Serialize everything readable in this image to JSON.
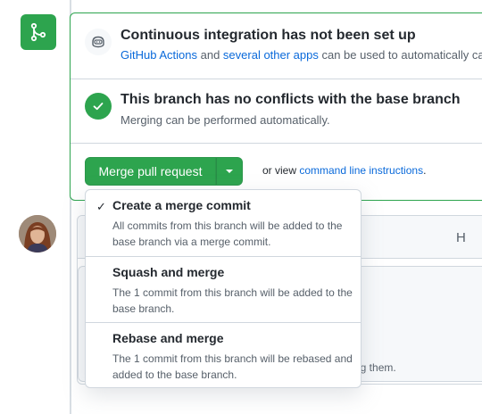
{
  "ci": {
    "title": "Continuous integration has not been set up",
    "link1": "GitHub Actions",
    "text1": " and ",
    "link2": "several other apps",
    "text2": " can be used to automatically ca"
  },
  "conflicts": {
    "title": "This branch has no conflicts with the base branch",
    "desc": "Merging can be performed automatically."
  },
  "merge": {
    "button_label": "Merge pull request",
    "or_view": "or view ",
    "cli_link": "command line instructions",
    "period": "."
  },
  "comment": {
    "heading_tool": "H",
    "hint": "ng them."
  },
  "merge_options": [
    {
      "title": "Create a merge commit",
      "desc": "All commits from this branch will be added to the base branch via a merge commit.",
      "selected": true,
      "check": "✓"
    },
    {
      "title": "Squash and merge",
      "desc": "The 1 commit from this branch will be added to the base branch.",
      "selected": false
    },
    {
      "title": "Rebase and merge",
      "desc": "The 1 commit from this branch will be rebased and added to the base branch.",
      "selected": false
    }
  ],
  "colors": {
    "accent_green": "#2da44e",
    "link_blue": "#0969da",
    "muted": "#57606a",
    "border": "#d0d7de"
  },
  "icons": {
    "merge_badge": "git-merge-icon",
    "ci": "copilot-bot-icon",
    "no_conflicts": "check-circle-icon",
    "caret": "triangle-down-icon",
    "check": "check-icon"
  }
}
